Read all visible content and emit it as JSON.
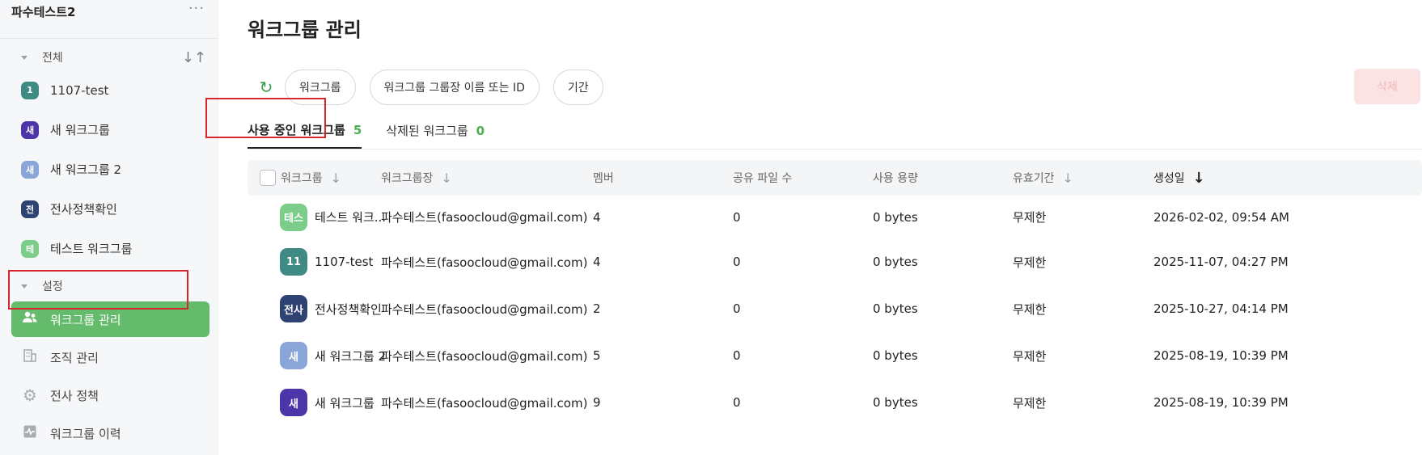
{
  "sidebar": {
    "workspace_title": "파수테스트2",
    "more_label": "···",
    "all_section": "전체",
    "sort_label": "↓↑",
    "groups": [
      {
        "label": "1107-test",
        "badge": "1",
        "color": "#3f8a82"
      },
      {
        "label": "새 워크그룹",
        "badge": "새",
        "color": "#4b35a8"
      },
      {
        "label": "새 워크그룹 2",
        "badge": "새",
        "color": "#8aa6d8"
      },
      {
        "label": "전사정책확인",
        "badge": "전",
        "color": "#2f4373"
      },
      {
        "label": "테스트 워크그룹",
        "badge": "테",
        "color": "#7ccc8a"
      }
    ],
    "settings_section": "설정",
    "nav": [
      {
        "label": "워크그룹 관리",
        "icon": "users-icon"
      },
      {
        "label": "조직 관리",
        "icon": "building-icon"
      },
      {
        "label": "전사 정책",
        "icon": "gear-icon"
      },
      {
        "label": "워크그룹 이력",
        "icon": "activity-icon"
      }
    ]
  },
  "main": {
    "title": "워크그룹 관리",
    "filters": {
      "workgroup": "워크그룹",
      "owner": "워크그룹 그룹장 이름 또는 ID",
      "period": "기간"
    },
    "delete_label": "삭제",
    "tabs": [
      {
        "label": "사용 중인 워크그룹",
        "count": "5"
      },
      {
        "label": "삭제된 워크그룹",
        "count": "0"
      }
    ],
    "columns": {
      "workgroup": "워크그룹",
      "owner": "워크그룹장",
      "members": "멤버",
      "shared_files": "공유 파일 수",
      "usage": "사용 용량",
      "validity": "유효기간",
      "created": "생성일"
    },
    "rows": [
      {
        "avatar": "테스",
        "color": "#7ccc8a",
        "name": "테스트 워크...",
        "owner": "파수테스트(fasoocloud@gmail.com)",
        "members": "4",
        "files": "0",
        "usage": "0 bytes",
        "validity": "무제한",
        "created": "2026-02-02, 09:54 AM"
      },
      {
        "avatar": "11",
        "color": "#3f8a82",
        "name": "1107-test",
        "owner": "파수테스트(fasoocloud@gmail.com)",
        "members": "4",
        "files": "0",
        "usage": "0 bytes",
        "validity": "무제한",
        "created": "2025-11-07, 04:27 PM"
      },
      {
        "avatar": "전사",
        "color": "#2f4373",
        "name": "전사정책확인",
        "owner": "파수테스트(fasoocloud@gmail.com)",
        "members": "2",
        "files": "0",
        "usage": "0 bytes",
        "validity": "무제한",
        "created": "2025-10-27, 04:14 PM"
      },
      {
        "avatar": "새",
        "color": "#8aa6d8",
        "name": "새 워크그룹 2",
        "owner": "파수테스트(fasoocloud@gmail.com)",
        "members": "5",
        "files": "0",
        "usage": "0 bytes",
        "validity": "무제한",
        "created": "2025-08-19, 10:39 PM"
      },
      {
        "avatar": "새",
        "color": "#4b35a8",
        "name": "새 워크그룹",
        "owner": "파수테스트(fasoocloud@gmail.com)",
        "members": "9",
        "files": "0",
        "usage": "0 bytes",
        "validity": "무제한",
        "created": "2025-08-19, 10:39 PM"
      }
    ]
  }
}
